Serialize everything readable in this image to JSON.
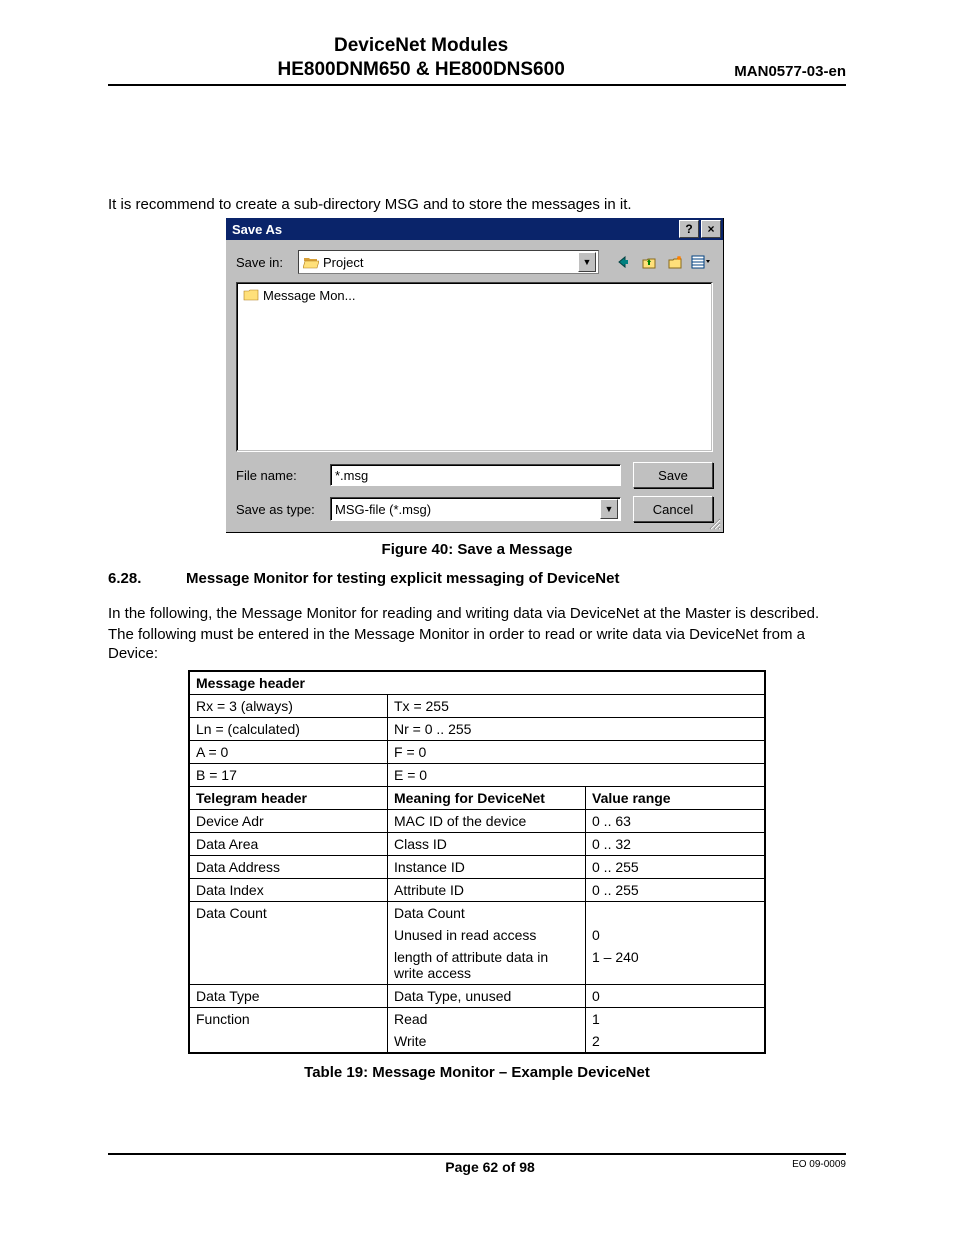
{
  "header": {
    "line1": "DeviceNet Modules",
    "line2": "HE800DNM650 & HE800DNS600",
    "manual": "MAN0577-03-en"
  },
  "intro_line": "It is recommend to create a sub-directory MSG and to store the messages in it.",
  "saveas": {
    "title": "Save As",
    "help_symbol": "?",
    "close_symbol": "×",
    "save_in_label": "Save in:",
    "save_in_value": "Project",
    "folder_item": "Message Mon...",
    "filename_label": "File name:",
    "filename_value": "*.msg",
    "savetype_label": "Save as type:",
    "savetype_value": "MSG-file (*.msg)",
    "save_btn": "Save",
    "cancel_btn": "Cancel"
  },
  "figure_caption": "Figure 40: Save a Message",
  "section": {
    "number": "6.28.",
    "title": "Message Monitor for testing explicit messaging of DeviceNet"
  },
  "para1": "In the following, the Message Monitor for reading and writing data via DeviceNet at the Master is described.",
  "para2": "The following must be entered in the Message Monitor in order to read or write data via DeviceNet from a Device:",
  "msg_table": {
    "header1": "Message header",
    "rows1": [
      [
        "Rx = 3 (always)",
        "Tx = 255"
      ],
      [
        "Ln = (calculated)",
        "Nr = 0 .. 255"
      ],
      [
        "A = 0",
        "F = 0"
      ],
      [
        "B = 17",
        "E = 0"
      ]
    ],
    "header2": [
      "Telegram header",
      "Meaning for DeviceNet",
      "Value range"
    ],
    "rows2": [
      [
        "Device Adr",
        "MAC ID of the device",
        "0 .. 63"
      ],
      [
        "Data Area",
        "Class ID",
        "0 .. 32"
      ],
      [
        "Data Address",
        "Instance ID",
        "0 .. 255"
      ],
      [
        "Data Index",
        "Attribute ID",
        "0 .. 255"
      ]
    ],
    "datacount": {
      "label": "Data Count",
      "r1": [
        "Data Count",
        ""
      ],
      "r2": [
        "Unused in read access",
        "0"
      ],
      "r3": [
        "length of attribute data in write access",
        "1 – 240"
      ]
    },
    "rows3": [
      [
        "Data Type",
        "Data Type, unused",
        "0"
      ]
    ],
    "func": {
      "label": "Function",
      "r1": [
        "Read",
        "1"
      ],
      "r2": [
        "Write",
        "2"
      ]
    }
  },
  "table_caption": "Table 19: Message Monitor – Example DeviceNet",
  "footer": {
    "page": "Page 62 of 98",
    "eo": "EO 09-0009"
  },
  "chart_data": [
    {
      "type": "table",
      "title": "Message header",
      "rows": [
        {
          "left": "Rx = 3 (always)",
          "right": "Tx = 255"
        },
        {
          "left": "Ln = (calculated)",
          "right": "Nr = 0 .. 255"
        },
        {
          "left": "A = 0",
          "right": "F = 0"
        },
        {
          "left": "B = 17",
          "right": "E = 0"
        }
      ]
    },
    {
      "type": "table",
      "title": "Telegram header",
      "columns": [
        "Telegram header",
        "Meaning for DeviceNet",
        "Value range"
      ],
      "rows": [
        {
          "Telegram header": "Device Adr",
          "Meaning for DeviceNet": "MAC ID of the device",
          "Value range": "0 .. 63"
        },
        {
          "Telegram header": "Data Area",
          "Meaning for DeviceNet": "Class ID",
          "Value range": "0 .. 32"
        },
        {
          "Telegram header": "Data Address",
          "Meaning for DeviceNet": "Instance ID",
          "Value range": "0 .. 255"
        },
        {
          "Telegram header": "Data Index",
          "Meaning for DeviceNet": "Attribute ID",
          "Value range": "0 .. 255"
        },
        {
          "Telegram header": "Data Count",
          "Meaning for DeviceNet": "Data Count",
          "Value range": ""
        },
        {
          "Telegram header": "",
          "Meaning for DeviceNet": "Unused in read access",
          "Value range": "0"
        },
        {
          "Telegram header": "",
          "Meaning for DeviceNet": "length of attribute data in write access",
          "Value range": "1 – 240"
        },
        {
          "Telegram header": "Data Type",
          "Meaning for DeviceNet": "Data Type, unused",
          "Value range": "0"
        },
        {
          "Telegram header": "Function",
          "Meaning for DeviceNet": "Read",
          "Value range": "1"
        },
        {
          "Telegram header": "",
          "Meaning for DeviceNet": "Write",
          "Value range": "2"
        }
      ]
    }
  ]
}
